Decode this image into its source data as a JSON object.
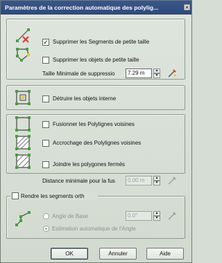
{
  "window": {
    "title": "Paramètres de la correction automatique des polylig...",
    "close_glyph": "✕"
  },
  "group1": {
    "remove_small_segments": {
      "label": "Supprimer les Segments de petite taille",
      "checked": true
    },
    "remove_small_objects": {
      "label": "Supprimer les objets de petite taille",
      "checked": false
    },
    "min_size": {
      "label": "Taille Minimale de suppressio",
      "value": "7.29 m"
    }
  },
  "group2": {
    "destroy_internal": {
      "label": "Détruire les objets interne",
      "checked": false
    }
  },
  "group3": {
    "merge_neighbors": {
      "label": "Fusionner les Polylignes voisines",
      "checked": false
    },
    "snap_neighbors": {
      "label": "Accrochage des Polylignes voisines",
      "checked": false
    },
    "join_closed": {
      "label": "Joindre les polygones fermés",
      "checked": false
    },
    "min_distance": {
      "label": "Distance minimale pour la fus",
      "value": "0.00 m"
    }
  },
  "group4": {
    "make_orthogonal": {
      "label": "Rendre les segments orth",
      "checked": false
    },
    "base_angle": {
      "label": "Angle de Base",
      "value": "0.0°",
      "selected": false
    },
    "auto_angle": {
      "label": "Estimation automatique de l'Angle",
      "selected": true
    }
  },
  "buttons": {
    "ok": "OK",
    "cancel": "Annuler",
    "help": "Aide"
  },
  "icons": {
    "segment_delete": "segment-delete-icon",
    "object_delete": "object-delete-icon",
    "pick": "pick-distance-icon",
    "internal": "internal-objects-icon",
    "merge": "merge-polylines-icon",
    "snap": "snap-polylines-icon",
    "join": "join-polygons-icon",
    "ortho": "orthogonal-segments-icon"
  },
  "colors": {
    "title_bar": "#2e4a7c",
    "node_green": "#3fa23a",
    "node_yellow": "#e8c82a",
    "accent_red": "#d8372b"
  }
}
